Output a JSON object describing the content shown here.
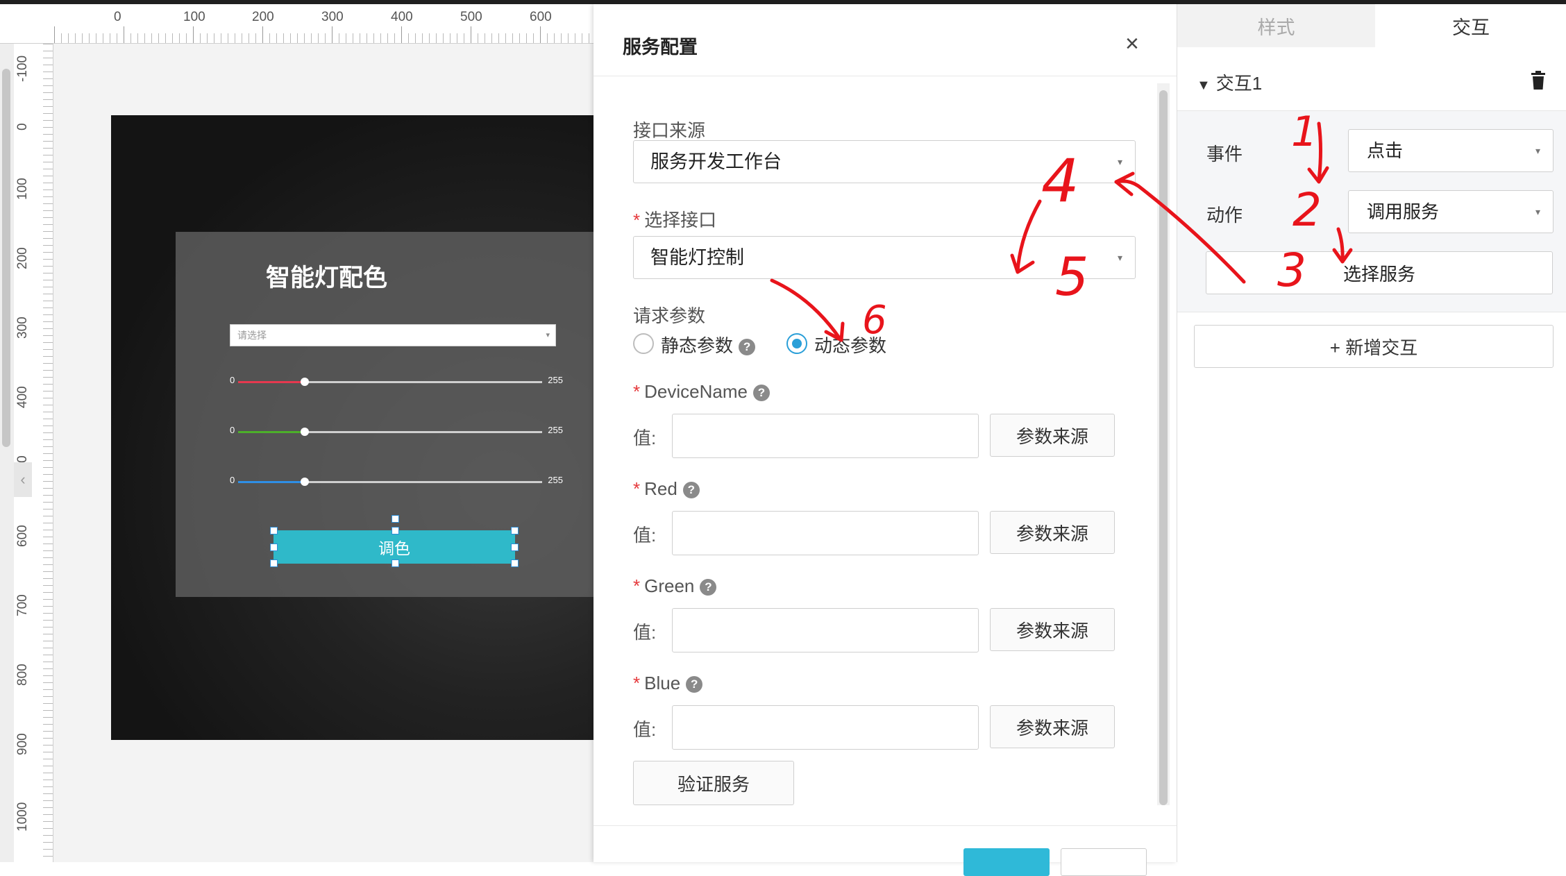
{
  "ruler": {
    "h_ticks": [
      "0",
      "100",
      "200",
      "300",
      "400",
      "500",
      "600"
    ],
    "v_ticks": [
      "-100",
      "0",
      "100",
      "200",
      "300",
      "400",
      "500",
      "600",
      "700",
      "800",
      "900",
      "1000"
    ]
  },
  "collapse_icon": "‹",
  "board": {
    "title": "智能灯配色",
    "select_placeholder": "请选择",
    "sliders": [
      {
        "min": "0",
        "max": "255",
        "color": "#e5384f",
        "level": 0.22
      },
      {
        "min": "0",
        "max": "255",
        "color": "#4caf2a",
        "level": 0.22
      },
      {
        "min": "0",
        "max": "255",
        "color": "#2f8fe6",
        "level": 0.22
      }
    ],
    "button_label": "调色"
  },
  "modal": {
    "title": "服务配置",
    "close_icon": "×",
    "source_label": "接口来源",
    "source_value": "服务开发工作台",
    "interface_label": "选择接口",
    "interface_value": "智能灯控制",
    "params_label": "请求参数",
    "static_label": "静态参数",
    "dynamic_label": "动态参数",
    "params": [
      {
        "name": "DeviceName",
        "value_label": "值:",
        "source_button": "参数来源"
      },
      {
        "name": "Red",
        "value_label": "值:",
        "source_button": "参数来源"
      },
      {
        "name": "Green",
        "value_label": "值:",
        "source_button": "参数来源"
      },
      {
        "name": "Blue",
        "value_label": "值:",
        "source_button": "参数来源"
      }
    ],
    "verify_button": "验证服务",
    "help_icon": "?"
  },
  "right_panel": {
    "tabs": [
      "样式",
      "交互"
    ],
    "interaction_title": "交互1",
    "event_label": "事件",
    "event_value": "点击",
    "action_label": "动作",
    "action_value": "调用服务",
    "choose_service_button": "选择服务",
    "add_interaction_button": "+ 新增交互"
  },
  "annotations": [
    "1",
    "2",
    "3",
    "4",
    "5",
    "6"
  ],
  "colors": {
    "accent": "#2fb9c9",
    "radio_active": "#2a9fd8",
    "annotation_red": "#e8141b"
  }
}
